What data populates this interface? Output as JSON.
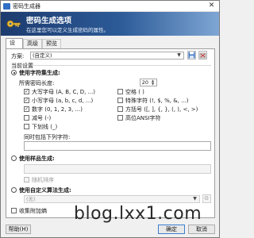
{
  "window": {
    "title": "密码生成器"
  },
  "banner": {
    "title": "密码生成选项",
    "subtitle": "在这里您可以定义生成密码的属性。"
  },
  "tabs": [
    {
      "label": "设置",
      "active": true
    },
    {
      "label": "高级",
      "active": false
    },
    {
      "label": "预览",
      "active": false
    }
  ],
  "profile": {
    "label": "方案:",
    "value": "(自定义)"
  },
  "current_settings": {
    "label": "当前设置"
  },
  "charset_option": {
    "label": "使用字符集生成:",
    "selected": true,
    "length_label": "所需密码长度:",
    "length_value": "20",
    "checkboxes": [
      {
        "label": "大写字母 (A, B, C, D, ...)",
        "checked": true
      },
      {
        "label": "空格 ( )",
        "checked": false
      },
      {
        "label": "小写字母 (a, b, c, d, ...)",
        "checked": true
      },
      {
        "label": "特殊字符 (!, $, %, &, ...)",
        "checked": false
      },
      {
        "label": "数字 (0, 1, 2, 3, ...)",
        "checked": true
      },
      {
        "label": "方括号 ([, ], {, }, (, ), <, >)",
        "checked": false
      },
      {
        "label": "减号 (-)",
        "checked": false
      },
      {
        "label": "高位ANSI字符",
        "checked": false
      },
      {
        "label": "下划线 (_)",
        "checked": false
      }
    ],
    "extra_label": "同时包括下列字符:",
    "extra_value": ""
  },
  "pattern_option": {
    "label": "使用样品生成:",
    "selected": false,
    "pattern_value": "",
    "random_order_label": "随机排序",
    "random_order_checked": false
  },
  "custom_option": {
    "label": "使用自定义算法生成:",
    "selected": false,
    "algorithm_value": "(无)"
  },
  "entropy": {
    "label": "收集附加熵",
    "checked": false
  },
  "buttons": {
    "help": "帮助(H)",
    "ok": "确定",
    "cancel": "取消"
  },
  "watermark": "blog.lxx1.com",
  "colors": {
    "banner_start": "#1d3b6e",
    "banner_end": "#7fa6d4",
    "accent": "#3c7fd1"
  }
}
